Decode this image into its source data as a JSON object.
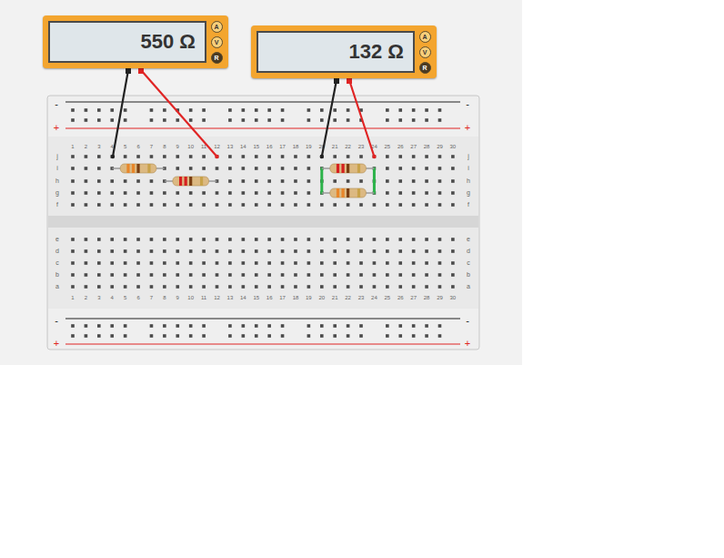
{
  "meters": [
    {
      "reading": "550 Ω",
      "modes": [
        {
          "label": "A",
          "selected": false
        },
        {
          "label": "V",
          "selected": false
        },
        {
          "label": "R",
          "selected": true
        }
      ],
      "leads": [
        {
          "color": "#222222"
        },
        {
          "color": "#e02424"
        }
      ]
    },
    {
      "reading": "132 Ω",
      "modes": [
        {
          "label": "A",
          "selected": false
        },
        {
          "label": "V",
          "selected": false
        },
        {
          "label": "R",
          "selected": true
        }
      ],
      "leads": [
        {
          "color": "#222222"
        },
        {
          "color": "#e02424"
        }
      ]
    }
  ],
  "breadboard": {
    "rail_labels": {
      "minus": "-",
      "plus": "+"
    },
    "columns": [
      "1",
      "2",
      "3",
      "4",
      "5",
      "6",
      "7",
      "8",
      "9",
      "10",
      "11",
      "12",
      "13",
      "14",
      "15",
      "16",
      "17",
      "18",
      "19",
      "20",
      "21",
      "22",
      "23",
      "24",
      "25",
      "26",
      "27",
      "28",
      "29",
      "30"
    ],
    "top_rows": [
      "j",
      "i",
      "h",
      "g",
      "f"
    ],
    "bottom_rows": [
      "e",
      "d",
      "c",
      "b",
      "a"
    ]
  },
  "resistors": [
    {
      "bands": [
        "#e8862a",
        "#e8862a",
        "#7a3e12",
        "#c8a24a"
      ]
    },
    {
      "bands": [
        "#d62020",
        "#d62020",
        "#7a3e12",
        "#c8a24a"
      ]
    },
    {
      "bands": [
        "#d62020",
        "#d62020",
        "#7a3e12",
        "#c8a24a"
      ]
    },
    {
      "bands": [
        "#e8862a",
        "#e8862a",
        "#7a3e12",
        "#c8a24a"
      ]
    }
  ],
  "jumpers": [
    {
      "color": "#2db34a"
    },
    {
      "color": "#2db34a"
    }
  ]
}
